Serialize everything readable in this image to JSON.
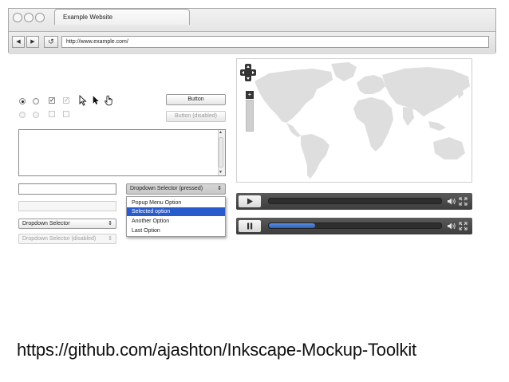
{
  "browser": {
    "tab_title": "Example Website",
    "url": "http://www.example.com/",
    "back_glyph": "◀",
    "forward_glyph": "▶",
    "reload_glyph": "↺"
  },
  "controls": {
    "checkbox_checked_glyph": "✓",
    "button_label": "Button",
    "button_disabled_label": "Button (disabled)",
    "dropdown_pressed_label": "Dropdown Selector (pressed)",
    "dropdown_label": "Dropdown Selector",
    "dropdown_disabled_label": "Dropdown Selector (disabled)",
    "dropdown_arrow": "⌃⌄",
    "menu_items": [
      "Popup Menu Option",
      "Selected option",
      "Another Option",
      "Last Option"
    ]
  },
  "media": {
    "player1_progress": 0.0,
    "player2_progress": 0.27
  },
  "footer": {
    "text": "https://github.com/ajashton/Inkscape-Mockup-Toolkit"
  }
}
